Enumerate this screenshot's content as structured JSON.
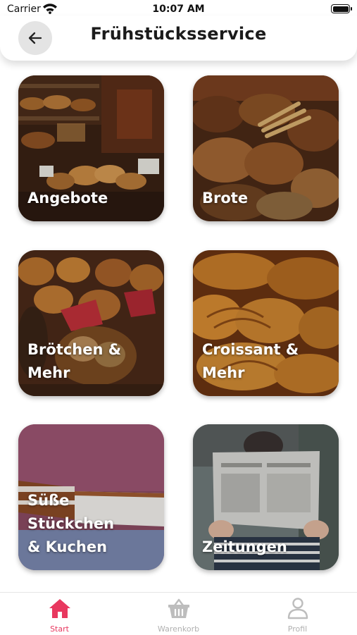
{
  "status_bar": {
    "carrier": "Carrier",
    "time": "10:07 AM"
  },
  "header": {
    "title": "Frühstücksservice"
  },
  "tiles": [
    {
      "label_lines": [
        "Angebote"
      ]
    },
    {
      "label_lines": [
        "Brote"
      ]
    },
    {
      "label_lines": [
        "Brötchen &",
        "Mehr"
      ]
    },
    {
      "label_lines": [
        "Croissant &",
        "Mehr"
      ]
    },
    {
      "label_lines": [
        "Süße Stückchen",
        "& Kuchen"
      ]
    },
    {
      "label_lines": [
        "Zeitungen"
      ]
    }
  ],
  "tab_bar": {
    "active_index": 0,
    "active_color": "#e8385f",
    "inactive_color": "#bdbdbd",
    "items": [
      {
        "label": "Start",
        "icon": "home-icon"
      },
      {
        "label": "Warenkorb",
        "icon": "basket-icon"
      },
      {
        "label": "Profil",
        "icon": "person-icon"
      }
    ]
  }
}
